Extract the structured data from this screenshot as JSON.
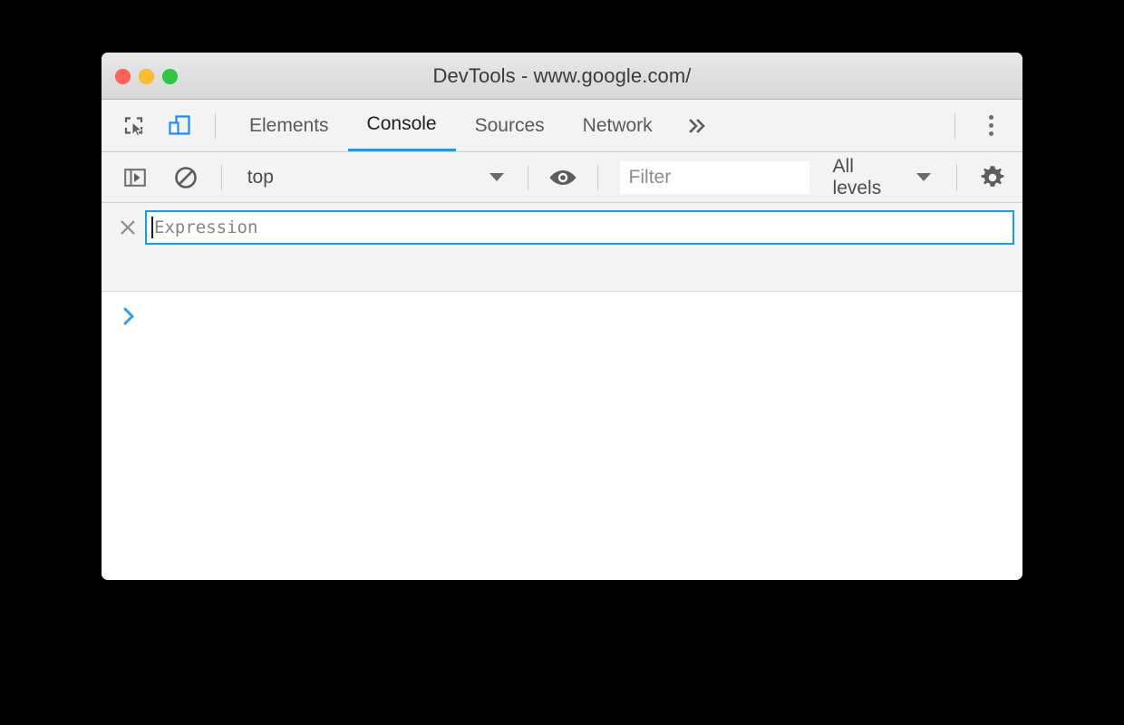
{
  "window": {
    "title": "DevTools - www.google.com/",
    "traffic_lights": [
      {
        "name": "close",
        "color": "#ff6159"
      },
      {
        "name": "minimize",
        "color": "#ffbd2e"
      },
      {
        "name": "zoom",
        "color": "#2ac940"
      }
    ]
  },
  "tabbar": {
    "inspect_icon": "inspect-element-icon",
    "device_icon": "device-toolbar-icon",
    "tabs": [
      {
        "label": "Elements",
        "active": false
      },
      {
        "label": "Console",
        "active": true
      },
      {
        "label": "Sources",
        "active": false
      },
      {
        "label": "Network",
        "active": false
      }
    ],
    "more_tabs_label": "»",
    "kebab_name": "customize-and-control-devtools",
    "active_tab_color": "#0aa2ed"
  },
  "console_toolbar": {
    "sidebar_toggle_icon": "console-sidebar-icon",
    "clear_icon": "clear-console-icon",
    "context": {
      "value": "top",
      "caret": "▼"
    },
    "eye_icon": "live-expression-eye-icon",
    "filter": {
      "value": "",
      "placeholder": "Filter"
    },
    "levels": {
      "value": "All levels",
      "caret": "▼"
    },
    "settings_icon": "gear-icon"
  },
  "live_expression": {
    "close_label": "×",
    "input_value": "",
    "input_placeholder": "Expression",
    "border_color": "#0aa2ed"
  },
  "console": {
    "prompt_symbol": "›",
    "prompt_color": "#2a9df4",
    "input_value": "",
    "messages": []
  }
}
